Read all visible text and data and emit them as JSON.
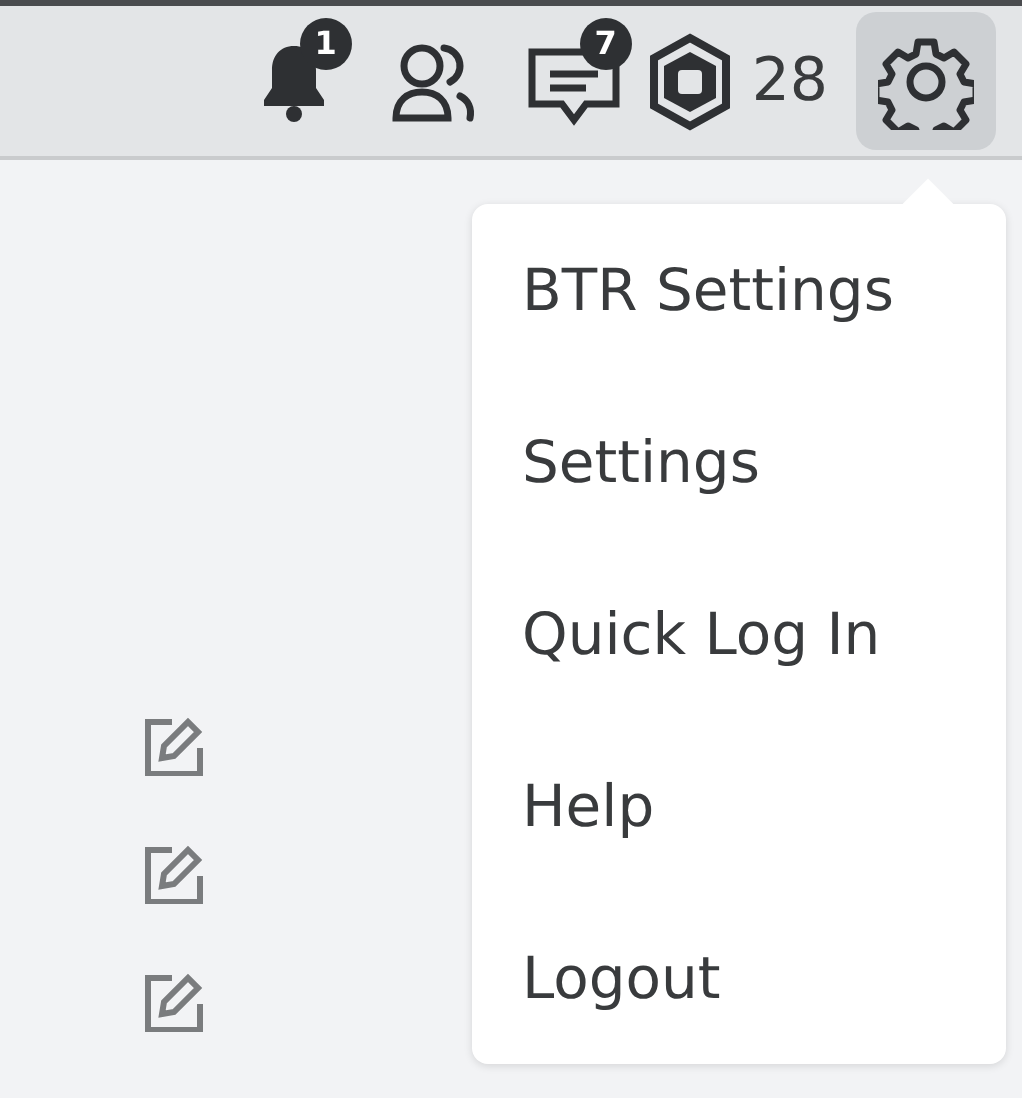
{
  "top_bar": {
    "notifications_badge": "1",
    "messages_badge": "7",
    "robux_balance": "28",
    "settings": {
      "expanded": true
    }
  },
  "settings_menu": {
    "items": [
      {
        "label": "BTR Settings"
      },
      {
        "label": "Settings"
      },
      {
        "label": "Quick Log In"
      },
      {
        "label": "Help"
      },
      {
        "label": "Logout"
      }
    ]
  },
  "edit_buttons": [
    {
      "kind": "edit"
    },
    {
      "kind": "edit"
    },
    {
      "kind": "edit"
    }
  ]
}
